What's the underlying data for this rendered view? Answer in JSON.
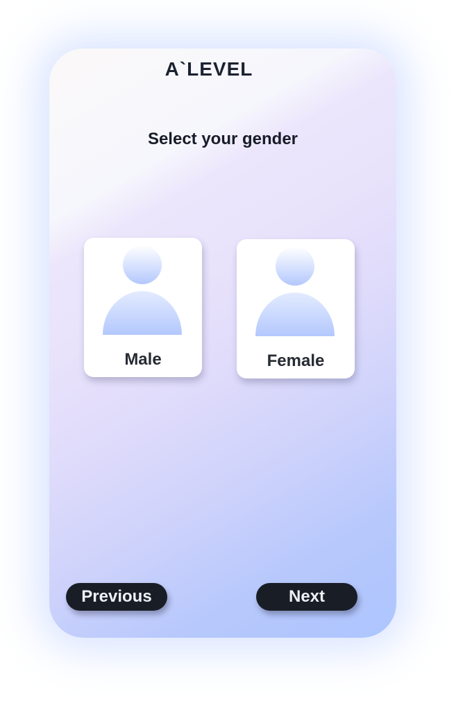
{
  "app": {
    "logo_text": "A`LEVEL"
  },
  "screen": {
    "title": "Select your gender"
  },
  "options": [
    {
      "label": "Male",
      "icon": "person-icon"
    },
    {
      "label": "Female",
      "icon": "person-icon"
    }
  ],
  "navigation": {
    "previous_label": "Previous",
    "next_label": "Next"
  },
  "colors": {
    "text_dark": "#1b2230",
    "button_bg": "#191e26",
    "button_text": "#eef0f6",
    "avatar_gradient_top": "#ffffff",
    "avatar_gradient_bottom": "#b3c8fd",
    "background_top": "#fbf9f8",
    "background_bottom": "#adc5fe"
  }
}
